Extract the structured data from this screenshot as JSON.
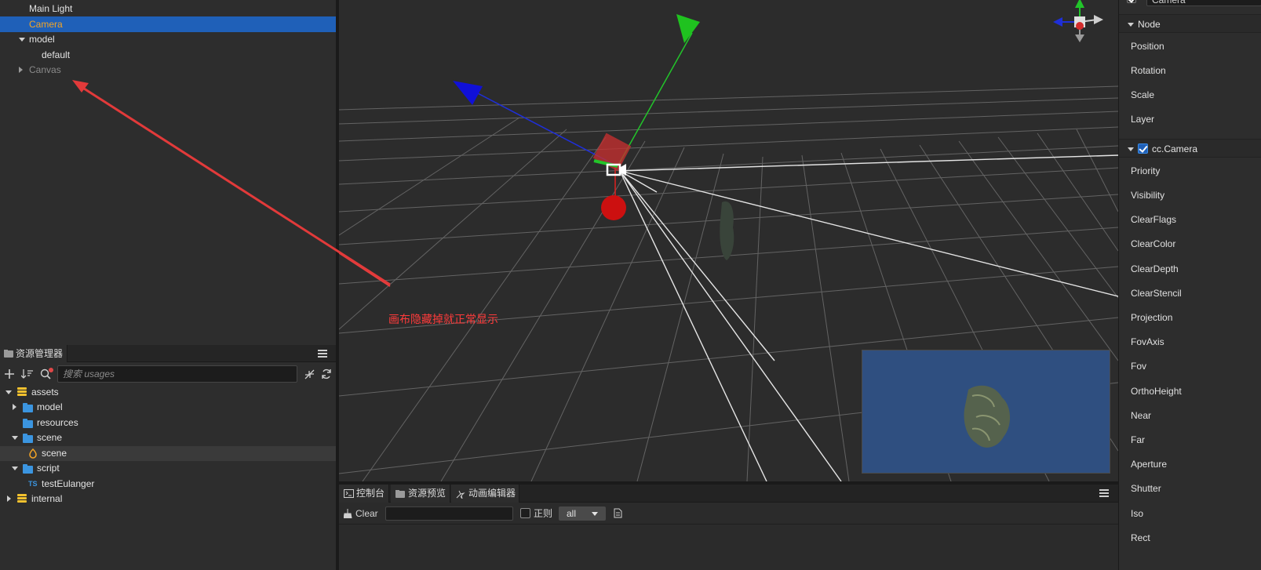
{
  "hierarchy": {
    "items": [
      {
        "label": "Main Light"
      },
      {
        "label": "Camera"
      },
      {
        "label": "model"
      },
      {
        "label": "default"
      },
      {
        "label": "Canvas"
      }
    ]
  },
  "assets": {
    "tab_label": "资源管理器",
    "search_placeholder": "搜索 usages",
    "tree": [
      {
        "label": "assets"
      },
      {
        "label": "model"
      },
      {
        "label": "resources"
      },
      {
        "label": "scene"
      },
      {
        "label": "scene"
      },
      {
        "label": "script"
      },
      {
        "label": "testEulanger",
        "badge": "TS"
      },
      {
        "label": "internal"
      }
    ]
  },
  "scene": {
    "annotation": "画布隐藏掉就正常显示",
    "annotation_color": "#ff3b3b",
    "preview_bg": "#2f4f80"
  },
  "console": {
    "tabs": [
      {
        "label": "控制台"
      },
      {
        "label": "资源预览"
      },
      {
        "label": "动画编辑器"
      }
    ],
    "clear_label": "Clear",
    "regex_label": "正则",
    "level_value": "all"
  },
  "inspector": {
    "node_name": "Camera",
    "node_section": "Node",
    "node_props": [
      "Position",
      "Rotation",
      "Scale",
      "Layer"
    ],
    "camera_section": "cc.Camera",
    "camera_props": [
      "Priority",
      "Visibility",
      "ClearFlags",
      "ClearColor",
      "ClearDepth",
      "ClearStencil",
      "Projection",
      "FovAxis",
      "Fov",
      "OrthoHeight",
      "Near",
      "Far",
      "Aperture",
      "Shutter",
      "Iso",
      "Rect"
    ]
  },
  "colors": {
    "selection": "#1f60b8",
    "selected_text": "#f4a425",
    "folder": "#3b95e0",
    "gizmo_x": "#e0201f",
    "gizmo_y": "#22c52a",
    "gizmo_z": "#1f2fd8"
  }
}
